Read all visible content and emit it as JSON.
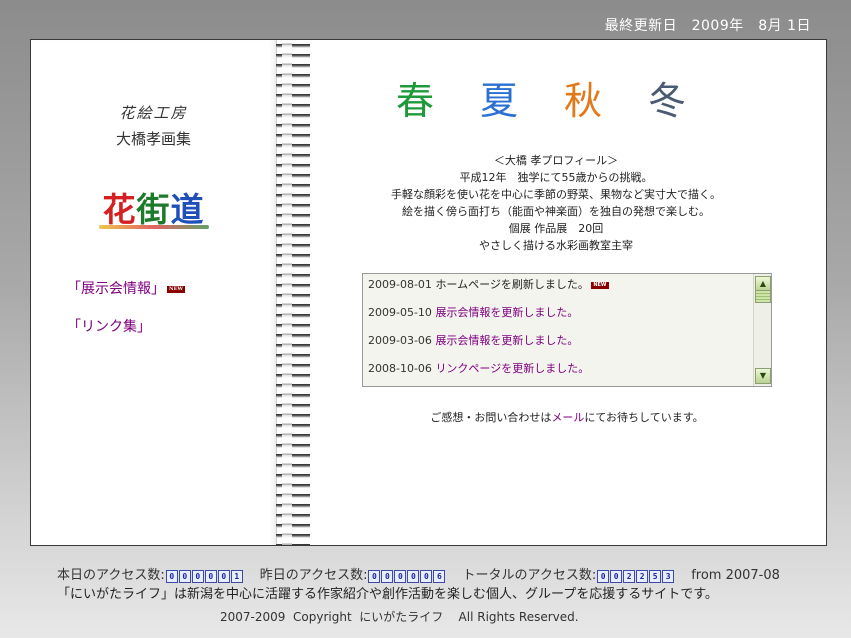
{
  "header": {
    "last_updated": "最終更新日　2009年　8月 1日"
  },
  "sidebar": {
    "brand_script": "花絵工房",
    "brand_title": "大橋孝画集",
    "logo_chars": [
      "花",
      "街",
      "道"
    ],
    "nav": [
      {
        "label": "「展示会情報」",
        "badge": "NEW"
      },
      {
        "label": "「リンク集」"
      }
    ]
  },
  "main": {
    "seasons": [
      {
        "char": "春",
        "color": "#1f9a3a"
      },
      {
        "char": "夏",
        "color": "#2b6fd1"
      },
      {
        "char": "秋",
        "color": "#e07a1a"
      },
      {
        "char": "冬",
        "color": "#4a5a70"
      }
    ],
    "profile": [
      "＜大橋 孝プロフィール＞",
      "平成12年　独学にて55歳からの挑戦。",
      "手軽な顔彩を使い花を中心に季節の野菜、果物など実寸大で描く。",
      "絵を描く傍ら面打ち（能面や神楽面）を独自の発想で楽しむ。",
      "個展 作品展　20回",
      "やさしく描ける水彩画教室主宰"
    ],
    "news": [
      {
        "date": "2009-08-01",
        "text": "ホームページを刷新しました。",
        "link": false,
        "badge": "NEW"
      },
      {
        "date": "2009-05-10",
        "text": "展示会情報を更新しました。",
        "link": true
      },
      {
        "date": "2009-03-06",
        "text": "展示会情報を更新しました。",
        "link": true
      },
      {
        "date": "2008-10-06",
        "text": "リンクページを更新しました。",
        "link": true
      }
    ],
    "contact": {
      "before": "ご感想・お問い合わせは",
      "link": "メール",
      "after": "にてお待ちしています。"
    }
  },
  "footer": {
    "today_label": "本日のアクセス数:",
    "today_digits": [
      "0",
      "0",
      "0",
      "0",
      "0",
      "1"
    ],
    "yesterday_label": "昨日のアクセス数:",
    "yesterday_digits": [
      "0",
      "0",
      "0",
      "0",
      "0",
      "6"
    ],
    "total_label": "トータルのアクセス数:",
    "total_digits": [
      "0",
      "0",
      "2",
      "2",
      "5",
      "3"
    ],
    "since": "from 2007-08",
    "description": "「にいがたライフ」は新潟を中心に活躍する作家紹介や創作活動を楽しむ個人、グループを応援するサイトです。",
    "copyright": "2007-2009  Copyright  にいがたライフ    All Rights Reserved."
  }
}
